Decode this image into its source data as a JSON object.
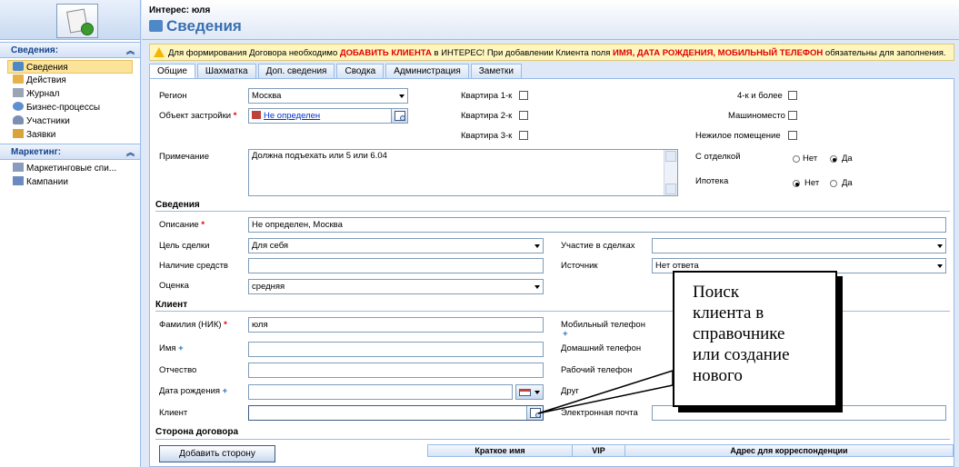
{
  "header": {
    "entity_type": "Интерес: юля",
    "title": "Сведения"
  },
  "nav": {
    "groups": [
      {
        "title": "Сведения:",
        "items": [
          {
            "label": "Сведения",
            "icon": "info-icon",
            "selected": true
          },
          {
            "label": "Действия",
            "icon": "activities-icon"
          },
          {
            "label": "Журнал",
            "icon": "journal-icon"
          },
          {
            "label": "Бизнес-процессы",
            "icon": "business-process-icon"
          },
          {
            "label": "Участники",
            "icon": "participants-icon"
          },
          {
            "label": "Заявки",
            "icon": "requests-icon"
          }
        ]
      },
      {
        "title": "Маркетинг:",
        "items": [
          {
            "label": "Маркетинговые спи...",
            "icon": "marketing-list-icon"
          },
          {
            "label": "Кампании",
            "icon": "campaigns-icon"
          }
        ]
      }
    ]
  },
  "notification": {
    "part1": "Для формирования Договора необходимо ",
    "bold1": "ДОБАВИТЬ КЛИЕНТА",
    "part2": " в ИНТЕРЕС! При добавлении Клиента поля ",
    "bold2": "ИМЯ, ДАТА РОЖДЕНИЯ, МОБИЛЬНЫЙ ТЕЛЕФОН",
    "part3": " обязательны для заполнения."
  },
  "tabs": [
    "Общие",
    "Шахматка",
    "Доп. сведения",
    "Сводка",
    "Администрация",
    "Заметки"
  ],
  "general": {
    "region_label": "Регион",
    "region_value": "Москва",
    "object_label": "Объект застройки",
    "object_value": "Не определен",
    "kv1_label": "Квартира 1-к",
    "kv2_label": "Квартира 2-к",
    "kv3_label": "Квартира 3-к",
    "k4_label": "4-к и более",
    "parking_label": "Машиноместо",
    "nonres_label": "Нежилое помещение",
    "note_label": "Примечание",
    "note_value": "Должна подъехать или 5 или 6.04",
    "finish_label": "С отделкой",
    "mortgage_label": "Ипотека",
    "no_label": "Нет",
    "yes_label": "Да",
    "finish_selected": "Да",
    "mortgage_selected": "Нет"
  },
  "details": {
    "section": "Сведения",
    "desc_label": "Описание",
    "desc_value": "Не определен, Москва",
    "goal_label": "Цель сделки",
    "goal_value": "Для себя",
    "participation_label": "Участие в сделках",
    "participation_value": "",
    "funds_label": "Наличие средств",
    "funds_value": "",
    "source_label": "Источник",
    "source_value": "Нет ответа",
    "rating_label": "Оценка",
    "rating_value": "средняя"
  },
  "client": {
    "section": "Клиент",
    "surname_label": "Фамилия (НИК)",
    "surname_value": "юля",
    "name_label": "Имя",
    "patronymic_label": "Отчество",
    "birth_label": "Дата рождения",
    "client_label": "Клиент",
    "mobile_label": "Мобильный телефон",
    "home_label": "Домашний телефон",
    "work_label": "Рабочий телефон",
    "other_label": "Друг",
    "email_label": "Электронная почта"
  },
  "party": {
    "section": "Сторона договора",
    "add_button": "Добавить сторону",
    "columns": [
      "Краткое имя",
      "VIP",
      "Адрес для корреспонденции"
    ]
  },
  "callout": {
    "lines": [
      "Поиск",
      "клиента в",
      "справочнике",
      "или создание",
      "нового"
    ]
  }
}
